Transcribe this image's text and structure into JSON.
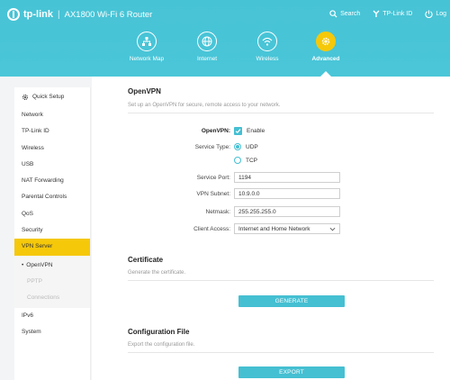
{
  "header": {
    "brand": "tp-link",
    "separator": "|",
    "model": "AX1800 Wi-Fi 6 Router",
    "search_label": "Search",
    "tplink_id_label": "TP-Link ID",
    "logout_label": "Log"
  },
  "nav": [
    {
      "label": "Network Map",
      "icon": "network-map-icon"
    },
    {
      "label": "Internet",
      "icon": "globe-icon"
    },
    {
      "label": "Wireless",
      "icon": "wifi-icon"
    },
    {
      "label": "Advanced",
      "icon": "gear-icon",
      "active": true
    }
  ],
  "sidebar": {
    "quick_setup": "Quick Setup",
    "items": [
      "Network",
      "TP-Link ID",
      "Wireless",
      "USB",
      "NAT Forwarding",
      "Parental Controls",
      "QoS",
      "Security",
      "VPN Server"
    ],
    "sub_items": [
      "OpenVPN",
      "PPTP",
      "Connections"
    ],
    "items_after": [
      "IPv6",
      "System"
    ],
    "active_color": "#f5c80a"
  },
  "openvpn": {
    "title": "OpenVPN",
    "description": "Set up an OpenVPN for secure, remote access to your network.",
    "openvpn_label": "OpenVPN:",
    "enable_label": "Enable",
    "enabled": true,
    "service_type_label": "Service Type:",
    "udp_label": "UDP",
    "tcp_label": "TCP",
    "service_type": "UDP",
    "service_port_label": "Service Port:",
    "service_port": "1194",
    "vpn_subnet_label": "VPN Subnet:",
    "vpn_subnet": "10.9.0.0",
    "netmask_label": "Netmask:",
    "netmask": "255.255.255.0",
    "client_access_label": "Client Access:",
    "client_access": "Internet and Home Network"
  },
  "certificate": {
    "title": "Certificate",
    "description": "Generate the certificate.",
    "button": "GENERATE"
  },
  "config_file": {
    "title": "Configuration File",
    "description": "Export the configuration file.",
    "button": "EXPORT"
  },
  "colors": {
    "header": "#47c3d6",
    "accent": "#45bfd2",
    "highlight": "#f5c80a"
  }
}
